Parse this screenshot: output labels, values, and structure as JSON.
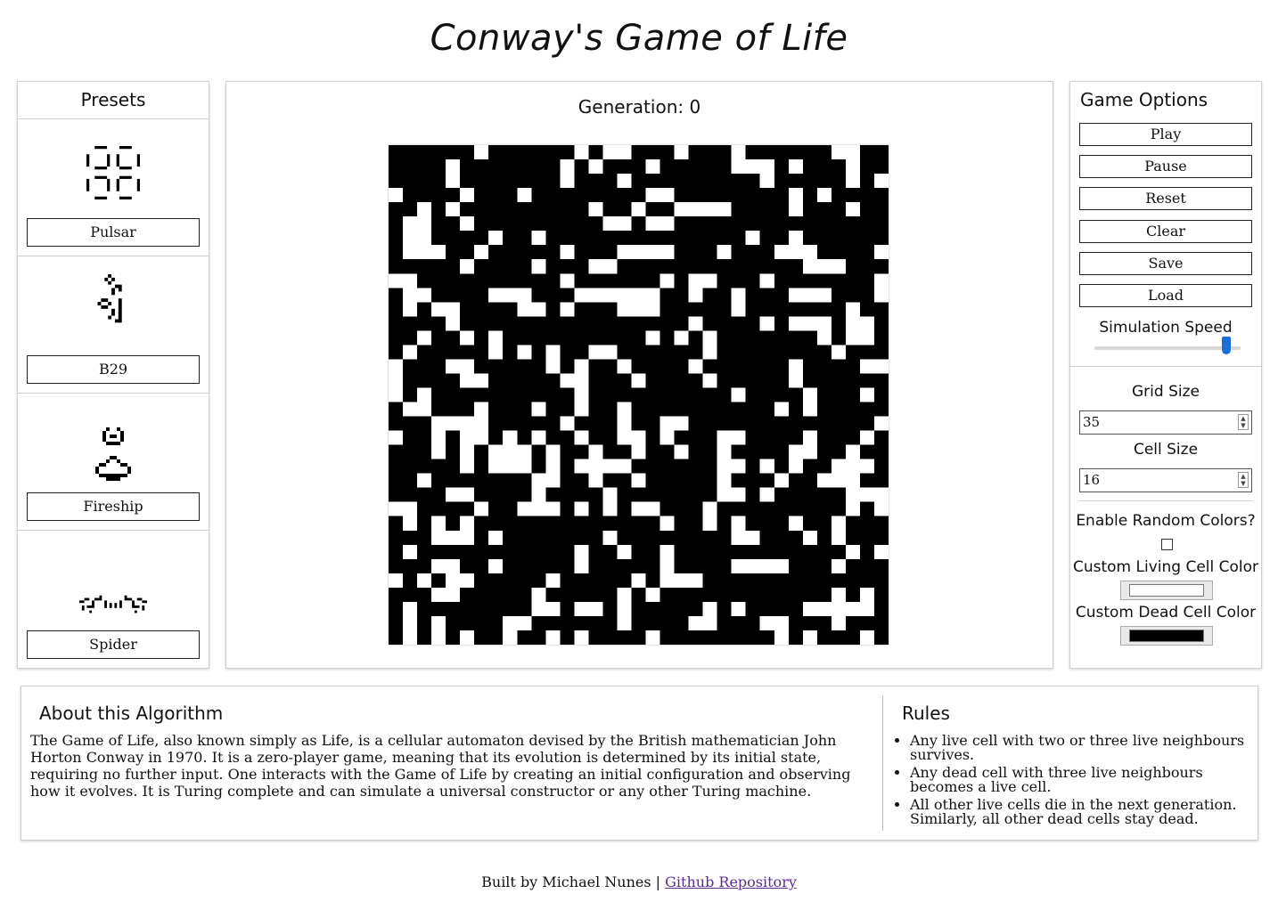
{
  "title": "Conway's Game of Life",
  "presets": {
    "heading": "Presets",
    "items": [
      {
        "label": "Pulsar"
      },
      {
        "label": "B29"
      },
      {
        "label": "Fireship"
      },
      {
        "label": "Spider"
      }
    ]
  },
  "board": {
    "generation_label": "Generation: 0",
    "grid_size": 35
  },
  "options": {
    "heading": "Game Options",
    "buttons": {
      "play": "Play",
      "pause": "Pause",
      "reset": "Reset",
      "clear": "Clear",
      "save": "Save",
      "load": "Load"
    },
    "speed_label": "Simulation Speed",
    "speed_value_fraction": 0.9,
    "grid_size_label": "Grid Size",
    "grid_size_value": "35",
    "cell_size_label": "Cell Size",
    "cell_size_value": "16",
    "random_colors_label": "Enable Random Colors?",
    "random_colors_checked": false,
    "living_color_label": "Custom Living Cell Color",
    "living_color": "#ffffff",
    "dead_color_label": "Custom Dead Cell Color",
    "dead_color": "#000000"
  },
  "about": {
    "heading": "About this Algorithm",
    "text": "The Game of Life, also known simply as Life, is a cellular automaton devised by the British mathematician John Horton Conway in 1970. It is a zero-player game, meaning that its evolution is determined by its initial state, requiring no further input. One interacts with the Game of Life by creating an initial configuration and observing how it evolves. It is Turing complete and can simulate a universal constructor or any other Turing machine.",
    "rules_heading": "Rules",
    "rules": [
      "Any live cell with two or three live neighbours survives.",
      "Any dead cell with three live neighbours becomes a live cell.",
      "All other live cells die in the next generation. Similarly, all other dead cells stay dead."
    ]
  },
  "footer": {
    "credit": "Built by Michael Nunes | ",
    "link_text": "Github Repository"
  }
}
